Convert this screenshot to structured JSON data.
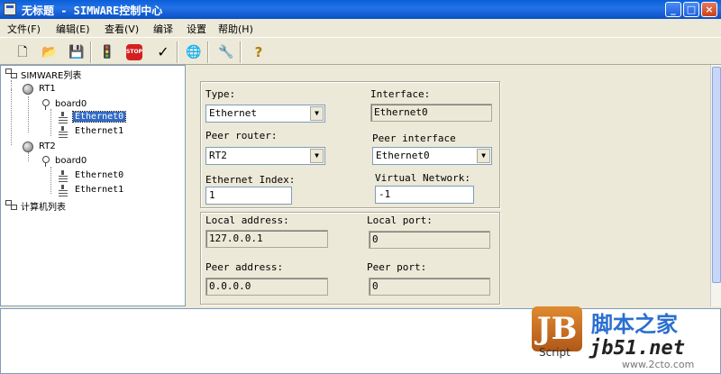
{
  "window": {
    "title": "无标题 - SIMWARE控制中心",
    "buttons": [
      "_",
      "□",
      "×"
    ]
  },
  "menu": [
    "文件(F)",
    "编辑(E)",
    "查看(V)",
    "编译",
    "设置",
    "帮助(H)"
  ],
  "toolbar": {
    "icons": [
      "new-icon",
      "open-icon",
      "save-icon",
      "traffic-light-icon",
      "stop-icon",
      "check-icon",
      "globe-icon",
      "wrench-icon",
      "help-icon"
    ],
    "glyphs": {
      "new": "🗋",
      "open": "📂",
      "save": "💾",
      "run": "🚦",
      "stop": "STOP",
      "check": "✓",
      "globe": "🌐",
      "wrench": "🔧",
      "help": "?"
    }
  },
  "tree": {
    "root1": "SIMWARE列表",
    "rt1": "RT1",
    "rt1_board": "board0",
    "rt1_eth0": "Ethernet0",
    "rt1_eth1": "Ethernet1",
    "rt2": "RT2",
    "rt2_board": "board0",
    "rt2_eth0": "Ethernet0",
    "rt2_eth1": "Ethernet1",
    "root2": "计算机列表"
  },
  "form": {
    "type_label": "Type:",
    "type_value": "Ethernet",
    "interface_label": "Interface:",
    "interface_value": "Ethernet0",
    "peer_router_label": "Peer router:",
    "peer_router_value": "RT2",
    "peer_interface_label": "Peer interface",
    "peer_interface_value": "Ethernet0",
    "eth_index_label": "Ethernet Index:",
    "eth_index_value": "1",
    "vnet_label": "Virtual Network:",
    "vnet_value": "-1",
    "local_addr_label": "Local address:",
    "local_addr_value": "127.0.0.1",
    "local_port_label": "Local port:",
    "local_port_value": "0",
    "peer_addr_label": "Peer address:",
    "peer_addr_value": "0.0.0.0",
    "peer_port_label": "Peer port:",
    "peer_port_value": "0"
  },
  "watermark": {
    "logo": "JB",
    "script": "Script",
    "cn": "脚本之家",
    "domain": "jb51.net",
    "sub": "www.2cto.com"
  }
}
